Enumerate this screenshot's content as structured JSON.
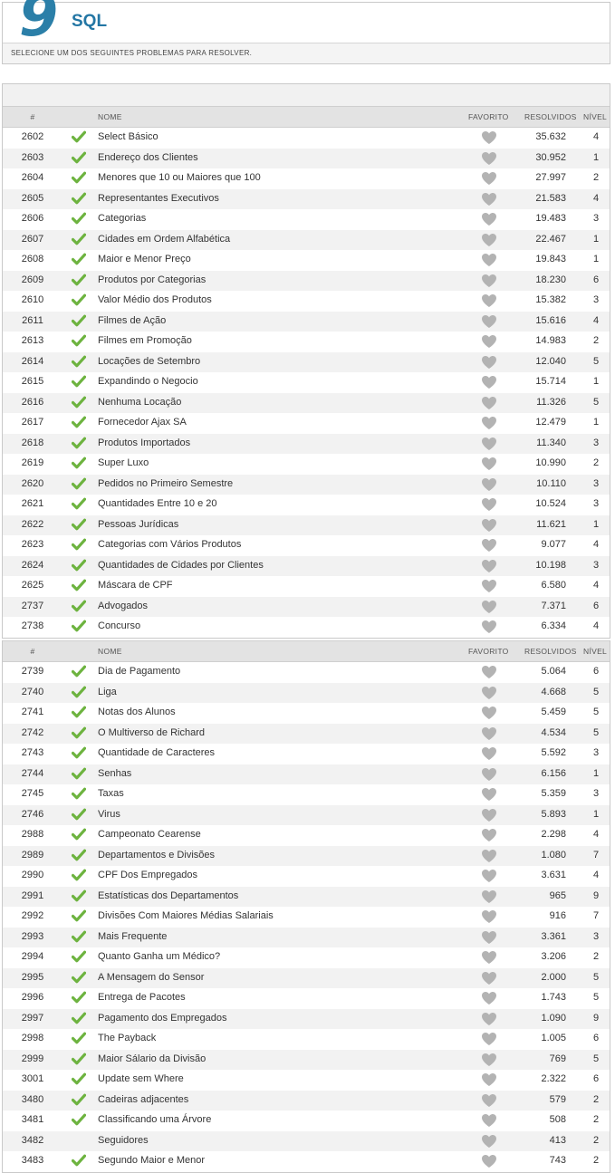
{
  "header": {
    "title": "SQL",
    "subtitle": "SELECIONE UM DOS SEGUINTES PROBLEMAS PARA RESOLVER.",
    "logo_icon": "category-9-logo-icon",
    "logo_color": "#2b7fa8",
    "accent_color": "#2376a4"
  },
  "columns": {
    "id": "#",
    "name": "NOME",
    "favorite": "FAVORITO",
    "solved": "RESOLVIDOS",
    "level": "NÍVEL"
  },
  "icons": {
    "solved": "check-icon",
    "favorite": "heart-icon",
    "solved_color": "#6db33f",
    "favorite_color": "#b3b3b3"
  },
  "table1": [
    {
      "id": "2602",
      "name": "Select Básico",
      "solved": "35.632",
      "level": "4",
      "done": true
    },
    {
      "id": "2603",
      "name": "Endereço dos Clientes",
      "solved": "30.952",
      "level": "1",
      "done": true
    },
    {
      "id": "2604",
      "name": "Menores que 10 ou Maiores que 100",
      "solved": "27.997",
      "level": "2",
      "done": true
    },
    {
      "id": "2605",
      "name": "Representantes Executivos",
      "solved": "21.583",
      "level": "4",
      "done": true
    },
    {
      "id": "2606",
      "name": "Categorias",
      "solved": "19.483",
      "level": "3",
      "done": true
    },
    {
      "id": "2607",
      "name": "Cidades em Ordem Alfabética",
      "solved": "22.467",
      "level": "1",
      "done": true
    },
    {
      "id": "2608",
      "name": "Maior e Menor Preço",
      "solved": "19.843",
      "level": "1",
      "done": true
    },
    {
      "id": "2609",
      "name": "Produtos por Categorias",
      "solved": "18.230",
      "level": "6",
      "done": true
    },
    {
      "id": "2610",
      "name": "Valor Médio dos Produtos",
      "solved": "15.382",
      "level": "3",
      "done": true
    },
    {
      "id": "2611",
      "name": "Filmes de Ação",
      "solved": "15.616",
      "level": "4",
      "done": true
    },
    {
      "id": "2613",
      "name": "Filmes em Promoção",
      "solved": "14.983",
      "level": "2",
      "done": true
    },
    {
      "id": "2614",
      "name": "Locações de Setembro",
      "solved": "12.040",
      "level": "5",
      "done": true
    },
    {
      "id": "2615",
      "name": "Expandindo o Negocio",
      "solved": "15.714",
      "level": "1",
      "done": true
    },
    {
      "id": "2616",
      "name": "Nenhuma Locação",
      "solved": "11.326",
      "level": "5",
      "done": true
    },
    {
      "id": "2617",
      "name": "Fornecedor Ajax SA",
      "solved": "12.479",
      "level": "1",
      "done": true
    },
    {
      "id": "2618",
      "name": "Produtos Importados",
      "solved": "11.340",
      "level": "3",
      "done": true
    },
    {
      "id": "2619",
      "name": "Super Luxo",
      "solved": "10.990",
      "level": "2",
      "done": true
    },
    {
      "id": "2620",
      "name": "Pedidos no Primeiro Semestre",
      "solved": "10.110",
      "level": "3",
      "done": true
    },
    {
      "id": "2621",
      "name": "Quantidades Entre 10 e 20",
      "solved": "10.524",
      "level": "3",
      "done": true
    },
    {
      "id": "2622",
      "name": "Pessoas Jurídicas",
      "solved": "11.621",
      "level": "1",
      "done": true
    },
    {
      "id": "2623",
      "name": "Categorias com Vários Produtos",
      "solved": "9.077",
      "level": "4",
      "done": true
    },
    {
      "id": "2624",
      "name": "Quantidades de Cidades por Clientes",
      "solved": "10.198",
      "level": "3",
      "done": true
    },
    {
      "id": "2625",
      "name": "Máscara de CPF",
      "solved": "6.580",
      "level": "4",
      "done": true
    },
    {
      "id": "2737",
      "name": "Advogados",
      "solved": "7.371",
      "level": "6",
      "done": true
    },
    {
      "id": "2738",
      "name": "Concurso",
      "solved": "6.334",
      "level": "4",
      "done": true
    }
  ],
  "table2": [
    {
      "id": "2739",
      "name": "Dia de Pagamento",
      "solved": "5.064",
      "level": "6",
      "done": true
    },
    {
      "id": "2740",
      "name": "Liga",
      "solved": "4.668",
      "level": "5",
      "done": true
    },
    {
      "id": "2741",
      "name": "Notas dos Alunos",
      "solved": "5.459",
      "level": "5",
      "done": true
    },
    {
      "id": "2742",
      "name": "O Multiverso de Richard",
      "solved": "4.534",
      "level": "5",
      "done": true
    },
    {
      "id": "2743",
      "name": "Quantidade de Caracteres",
      "solved": "5.592",
      "level": "3",
      "done": true
    },
    {
      "id": "2744",
      "name": "Senhas",
      "solved": "6.156",
      "level": "1",
      "done": true
    },
    {
      "id": "2745",
      "name": "Taxas",
      "solved": "5.359",
      "level": "3",
      "done": true
    },
    {
      "id": "2746",
      "name": "Virus",
      "solved": "5.893",
      "level": "1",
      "done": true
    },
    {
      "id": "2988",
      "name": "Campeonato Cearense",
      "solved": "2.298",
      "level": "4",
      "done": true
    },
    {
      "id": "2989",
      "name": "Departamentos e Divisões",
      "solved": "1.080",
      "level": "7",
      "done": true
    },
    {
      "id": "2990",
      "name": "CPF Dos Empregados",
      "solved": "3.631",
      "level": "4",
      "done": true
    },
    {
      "id": "2991",
      "name": "Estatísticas dos Departamentos",
      "solved": "965",
      "level": "9",
      "done": true
    },
    {
      "id": "2992",
      "name": "Divisões Com Maiores Médias Salariais",
      "solved": "916",
      "level": "7",
      "done": true
    },
    {
      "id": "2993",
      "name": "Mais Frequente",
      "solved": "3.361",
      "level": "3",
      "done": true
    },
    {
      "id": "2994",
      "name": "Quanto Ganha um Médico?",
      "solved": "3.206",
      "level": "2",
      "done": true
    },
    {
      "id": "2995",
      "name": "A Mensagem do Sensor",
      "solved": "2.000",
      "level": "5",
      "done": true
    },
    {
      "id": "2996",
      "name": "Entrega de Pacotes",
      "solved": "1.743",
      "level": "5",
      "done": true
    },
    {
      "id": "2997",
      "name": "Pagamento dos Empregados",
      "solved": "1.090",
      "level": "9",
      "done": true
    },
    {
      "id": "2998",
      "name": "The Payback",
      "solved": "1.005",
      "level": "6",
      "done": true
    },
    {
      "id": "2999",
      "name": "Maior Sálario da Divisão",
      "solved": "769",
      "level": "5",
      "done": true
    },
    {
      "id": "3001",
      "name": "Update sem Where",
      "solved": "2.322",
      "level": "6",
      "done": true
    },
    {
      "id": "3480",
      "name": "Cadeiras adjacentes",
      "solved": "579",
      "level": "2",
      "done": true
    },
    {
      "id": "3481",
      "name": "Classificando uma Árvore",
      "solved": "508",
      "level": "2",
      "done": true
    },
    {
      "id": "3482",
      "name": "Seguidores",
      "solved": "413",
      "level": "2",
      "done": false
    },
    {
      "id": "3483",
      "name": "Segundo Maior e Menor",
      "solved": "743",
      "level": "2",
      "done": true
    }
  ]
}
